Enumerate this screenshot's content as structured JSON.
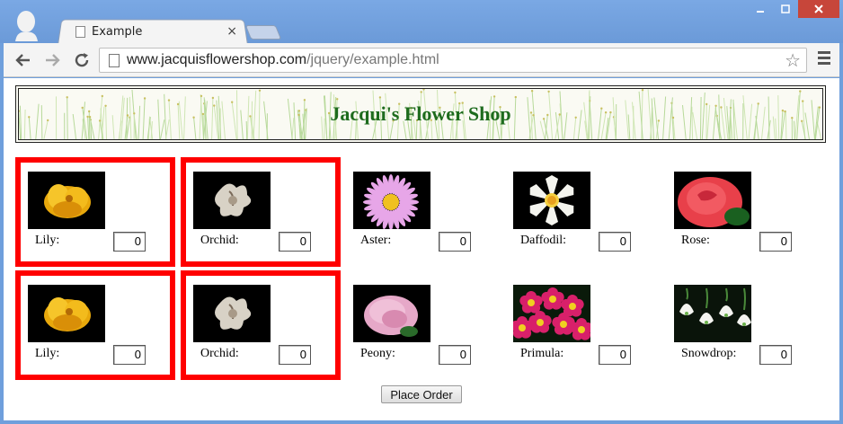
{
  "browser": {
    "tab_title": "Example",
    "tab_close": "×",
    "url_host": "www.jacquisflowershop.com",
    "url_path": "/jquery/example.html"
  },
  "page": {
    "shop_title": "Jacqui's Flower Shop",
    "place_order_label": "Place Order"
  },
  "flowers": [
    {
      "name": "Lily:",
      "quantity": "0",
      "selected": true,
      "image": "yellow-lily"
    },
    {
      "name": "Orchid:",
      "quantity": "0",
      "selected": true,
      "image": "white-orchid"
    },
    {
      "name": "Aster:",
      "quantity": "0",
      "selected": false,
      "image": "pink-aster"
    },
    {
      "name": "Daffodil:",
      "quantity": "0",
      "selected": false,
      "image": "white-daffodil"
    },
    {
      "name": "Rose:",
      "quantity": "0",
      "selected": false,
      "image": "red-rose"
    },
    {
      "name": "Lily:",
      "quantity": "0",
      "selected": true,
      "image": "yellow-lily"
    },
    {
      "name": "Orchid:",
      "quantity": "0",
      "selected": true,
      "image": "white-orchid"
    },
    {
      "name": "Peony:",
      "quantity": "0",
      "selected": false,
      "image": "pink-peony"
    },
    {
      "name": "Primula:",
      "quantity": "0",
      "selected": false,
      "image": "magenta-primula"
    },
    {
      "name": "Snowdrop:",
      "quantity": "0",
      "selected": false,
      "image": "white-snowdrop"
    }
  ],
  "colors": {
    "selection_border": "#ff0000",
    "title_green": "#1d6b1d"
  }
}
